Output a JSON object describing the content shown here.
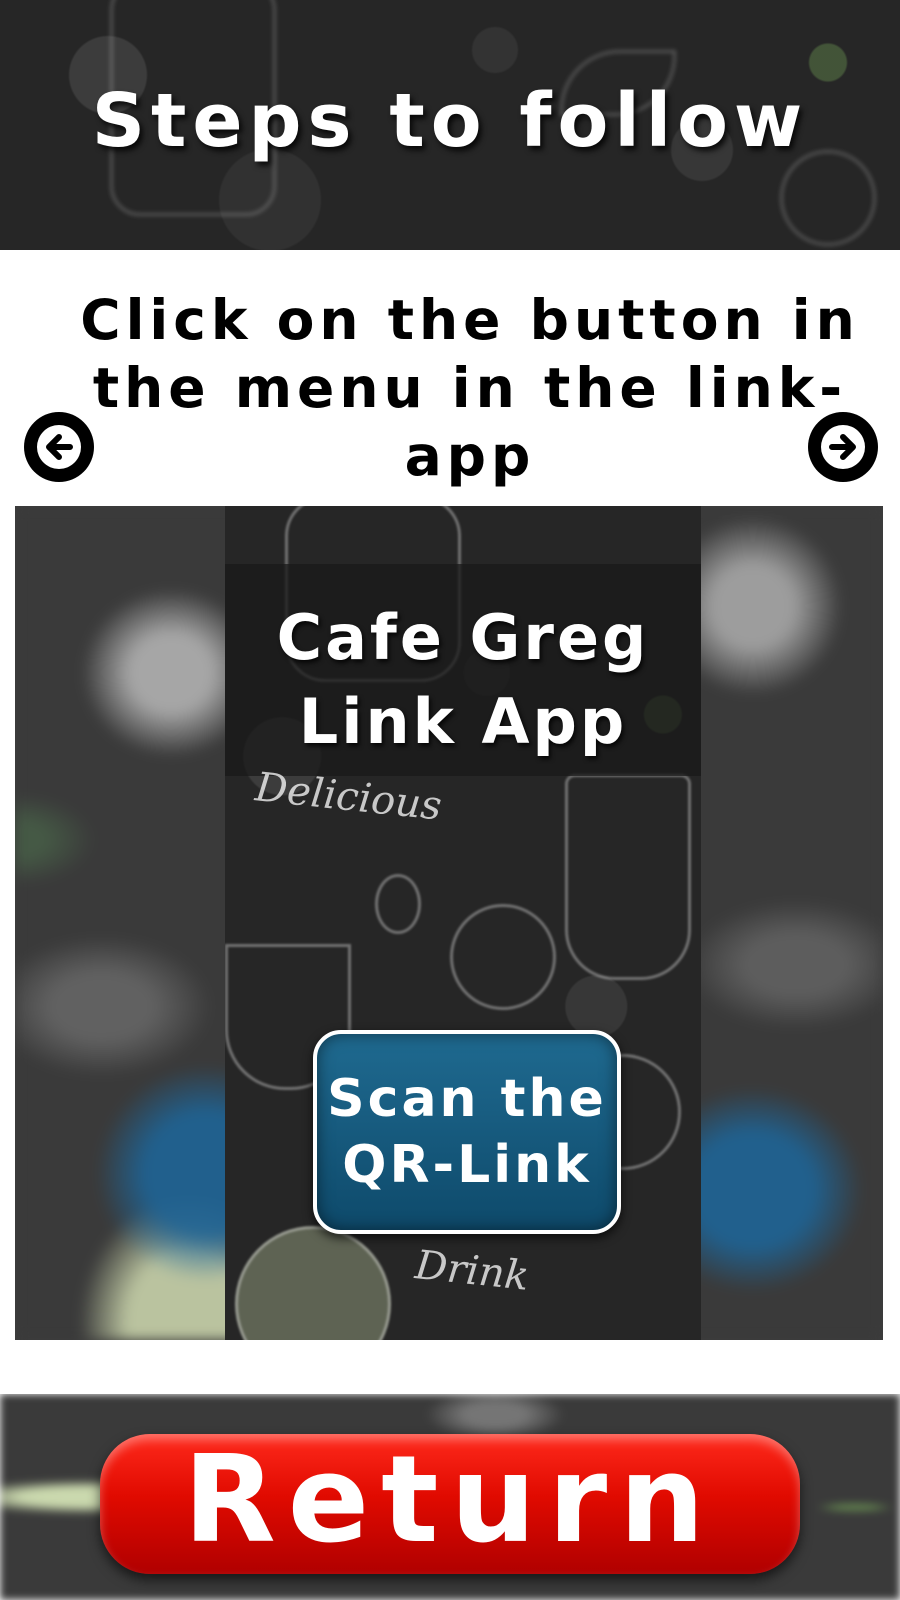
{
  "header": {
    "title": "Steps to follow"
  },
  "instruction": {
    "text": "Click on the button in the menu in the link-app"
  },
  "navigation": {
    "prev_icon": "arrow-left-circle-icon",
    "next_icon": "arrow-right-circle-icon"
  },
  "preview": {
    "app_title": "Cafe Greg Link App",
    "scan_button_label": "Scan the\nQR-Link",
    "decor_text_top": "Delicious",
    "decor_text_bottom": "Drink"
  },
  "footer": {
    "return_label": "Return"
  },
  "colors": {
    "header_bg": "#262626",
    "scan_button": "#0e4a6b",
    "return_button": "#e00a00"
  }
}
